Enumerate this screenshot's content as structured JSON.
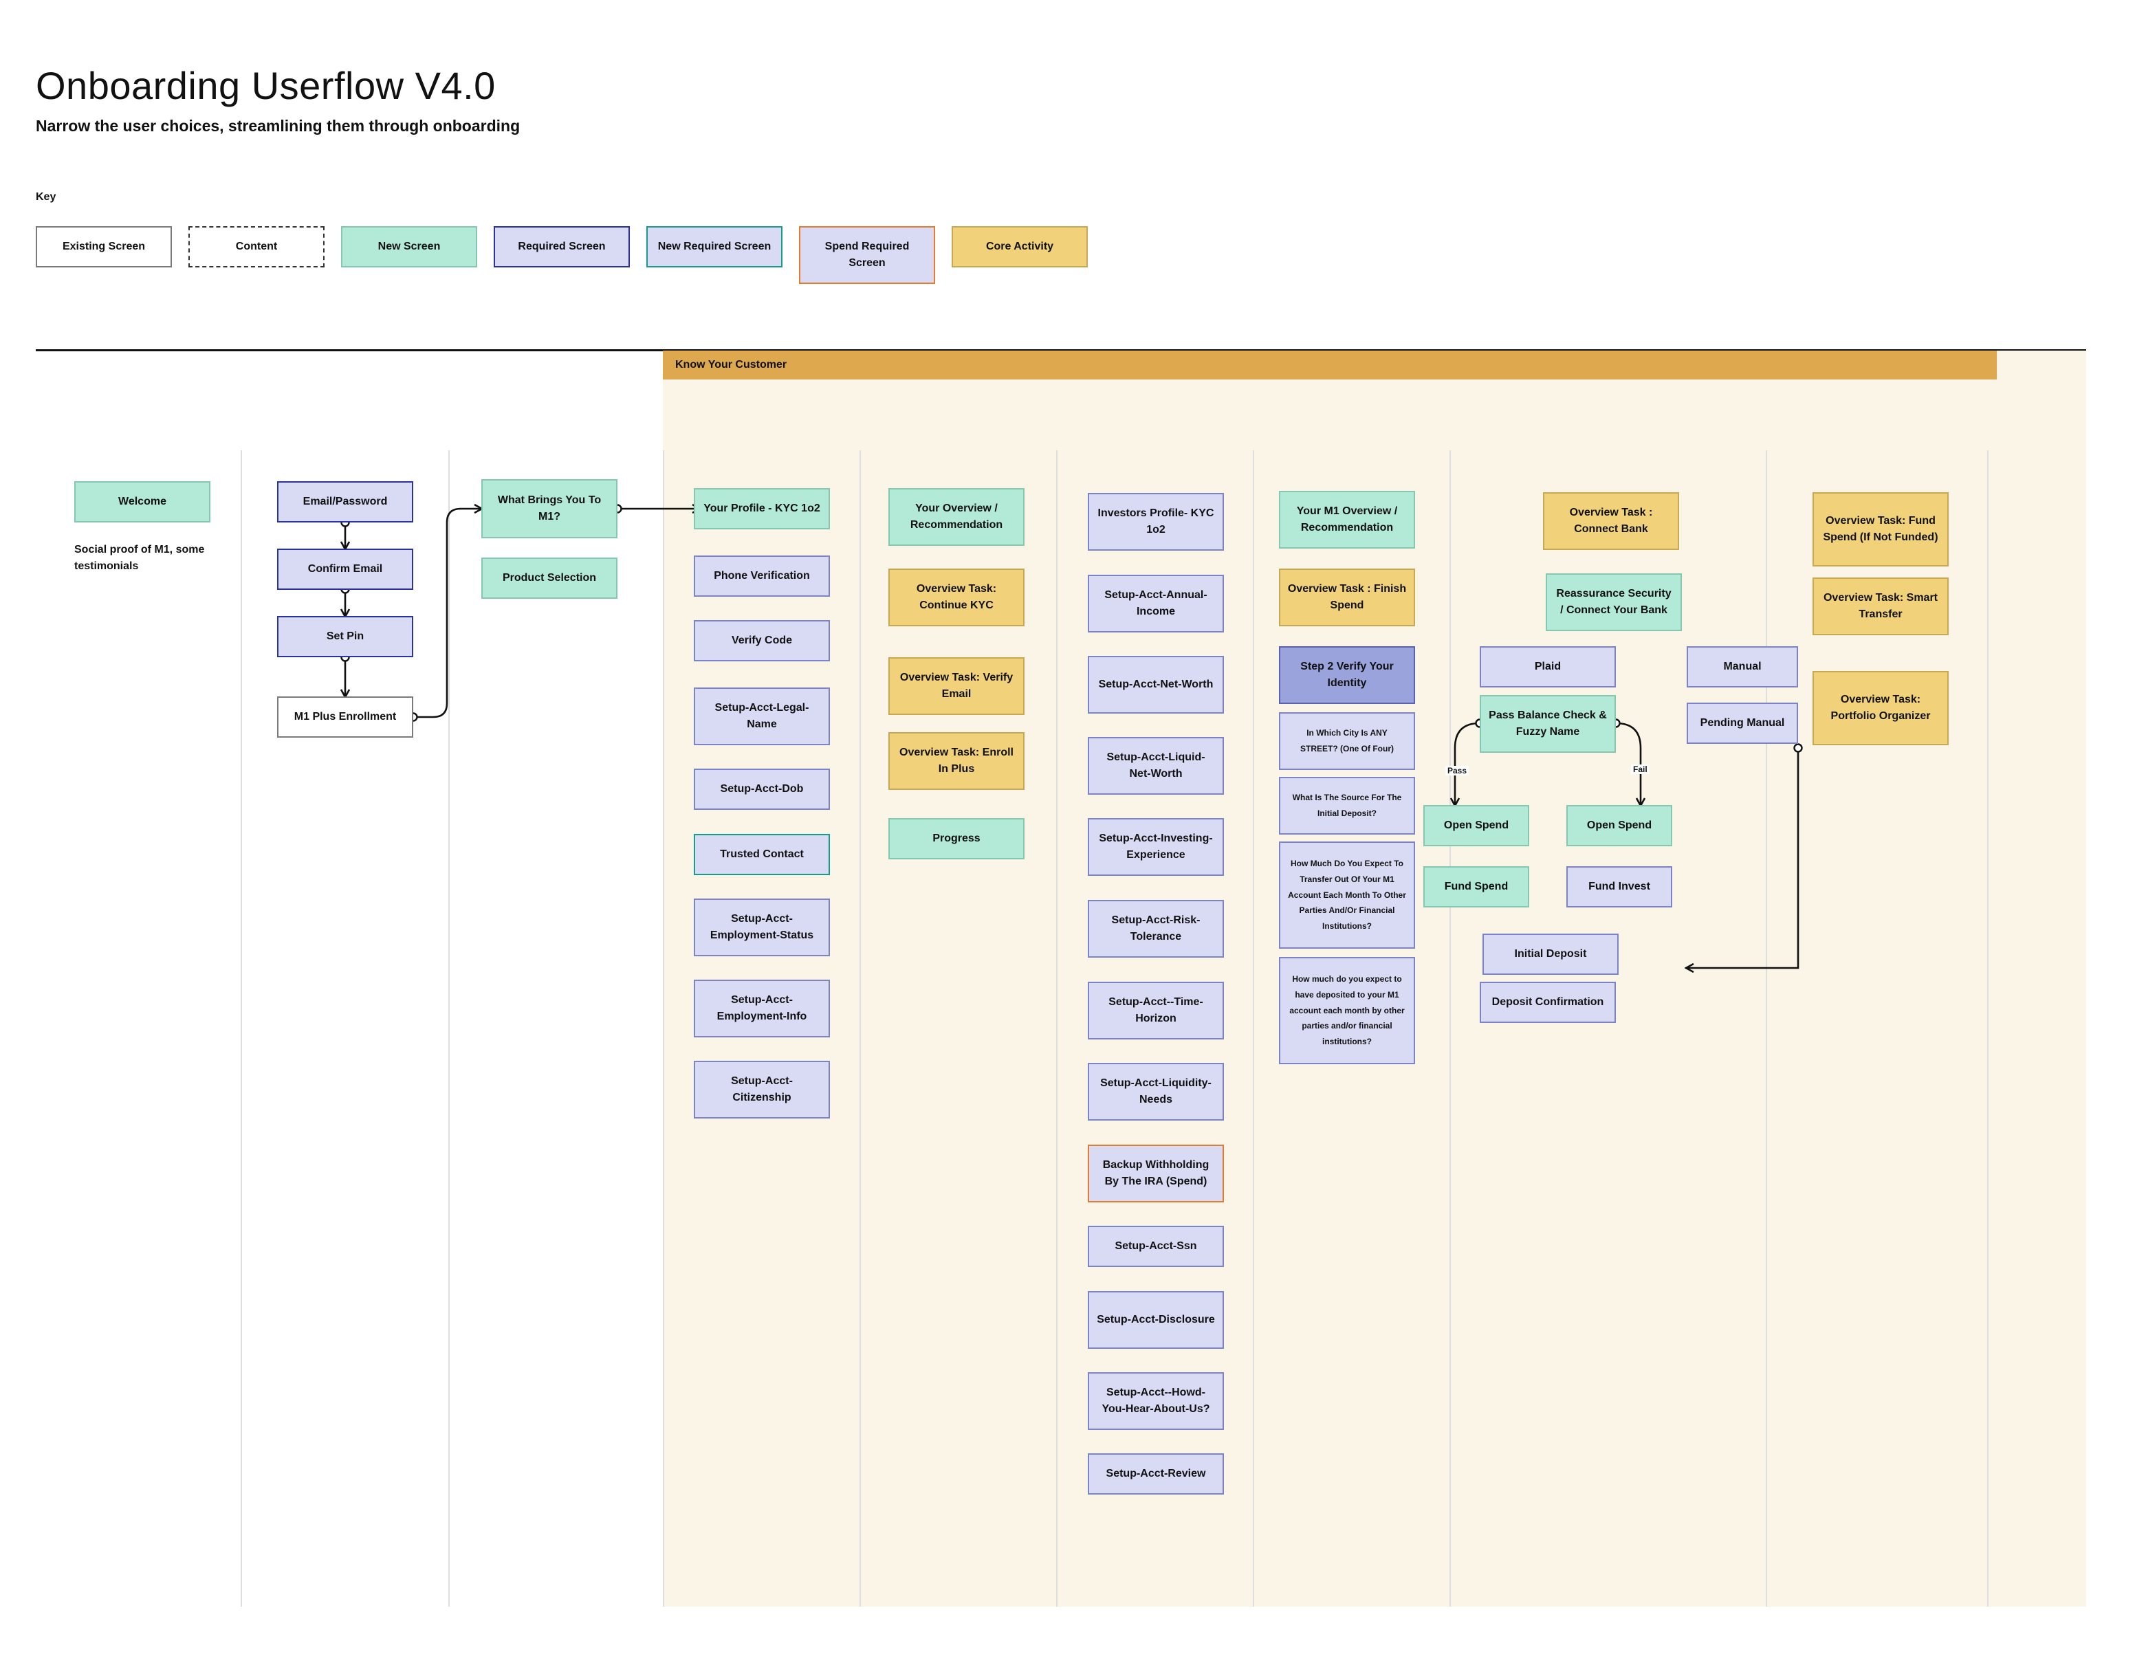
{
  "header": {
    "title": "Onboarding Userflow V4.0",
    "subtitle": "Narrow the user choices, streamlining them through onboarding"
  },
  "key": {
    "label": "Key",
    "items": [
      {
        "label": "Existing Screen"
      },
      {
        "label": "Content"
      },
      {
        "label": "New Screen"
      },
      {
        "label": "Required Screen"
      },
      {
        "label": "New Required Screen"
      },
      {
        "label": "Spend Required Screen"
      },
      {
        "label": "Core Activity"
      }
    ]
  },
  "kyc_section": {
    "label": "Know Your Customer"
  },
  "col1": {
    "welcome": "Welcome",
    "note": "Social proof of M1, some testimonials"
  },
  "col2": {
    "email_password": "Email/Password",
    "confirm_email": "Confirm Email",
    "set_pin": "Set Pin",
    "m1_plus_enrollment": "M1 Plus Enrollment"
  },
  "col3": {
    "what_brings": "What Brings You To M1?",
    "product_selection": "Product Selection"
  },
  "col4": {
    "items": [
      "Your Profile - KYC 1o2",
      "Phone Verification",
      "Verify Code",
      "Setup-Acct-Legal-Name",
      "Setup-Acct-Dob",
      "Trusted Contact",
      "Setup-Acct-Employment-Status",
      "Setup-Acct-Employment-Info",
      "Setup-Acct-Citizenship"
    ]
  },
  "col5": {
    "items": [
      "Your Overview / Recommendation",
      "Overview Task: Continue KYC",
      "Overview Task: Verify Email",
      "Overview Task: Enroll In Plus",
      "Progress"
    ]
  },
  "col6": {
    "items": [
      "Investors Profile- KYC 1o2",
      "Setup-Acct-Annual-Income",
      "Setup-Acct-Net-Worth",
      "Setup-Acct-Liquid-Net-Worth",
      "Setup-Acct-Investing-Experience",
      "Setup-Acct-Risk-Tolerance",
      "Setup-Acct--Time-Horizon",
      "Setup-Acct-Liquidity-Needs",
      "Backup Withholding By The IRA (Spend)",
      "Setup-Acct-Ssn",
      "Setup-Acct-Disclosure",
      "Setup-Acct--Howd-You-Hear-About-Us?",
      "Setup-Acct-Review"
    ]
  },
  "col7": {
    "items": [
      "Your M1 Overview / Recommendation",
      "Overview Task : Finish Spend",
      "Step 2 Verify Your Identity",
      "In Which City Is ANY STREET? (One Of Four)",
      "What Is The Source For The Initial Deposit?",
      "How Much Do You Expect To Transfer Out Of Your M1 Account Each Month To Other Parties And/Or Financial Institutions?",
      "How much do you expect to have deposited to your M1 account each month by other parties and/or financial institutions?"
    ]
  },
  "col8": {
    "connect_bank": "Overview Task : Connect Bank",
    "reassurance": "Reassurance Security / Connect Your Bank",
    "plaid": "Plaid",
    "manual": "Manual",
    "pass_balance": "Pass Balance Check & Fuzzy Name",
    "pending_manual": "Pending Manual",
    "pass_label": "Pass",
    "fail_label": "Fail",
    "open_spend_pass": "Open Spend",
    "open_spend_fail": "Open Spend",
    "fund_spend": "Fund Spend",
    "fund_invest": "Fund Invest",
    "initial_deposit": "Initial Deposit",
    "deposit_confirmation": "Deposit Confirmation"
  },
  "col9": {
    "items": [
      "Overview Task: Fund Spend (If Not Funded)",
      "Overview Task: Smart Transfer",
      "Overview Task: Portfolio Organizer"
    ]
  }
}
